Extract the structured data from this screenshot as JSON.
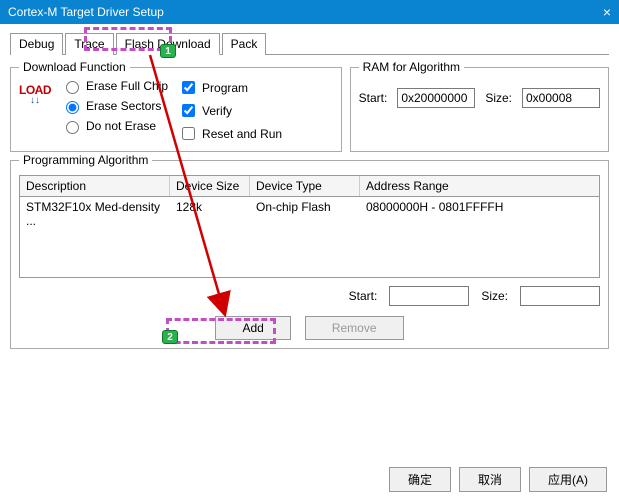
{
  "window": {
    "title": "Cortex-M Target Driver Setup"
  },
  "tabs": {
    "debug": "Debug",
    "trace": "Trace",
    "flash": "Flash Download",
    "pack": "Pack"
  },
  "download_function": {
    "legend": "Download Function",
    "icon_text": "LOAD",
    "radio_erase_full": "Erase Full Chip",
    "radio_erase_sectors": "Erase Sectors",
    "radio_do_not_erase": "Do not Erase",
    "chk_program": "Program",
    "chk_verify": "Verify",
    "chk_reset_run": "Reset and Run"
  },
  "ram_algorithm": {
    "legend": "RAM for Algorithm",
    "start_label": "Start:",
    "start_value": "0x20000000",
    "size_label": "Size:",
    "size_value": "0x00008"
  },
  "programming_algorithm": {
    "legend": "Programming Algorithm",
    "headers": {
      "desc": "Description",
      "size": "Device Size",
      "type": "Device Type",
      "addr": "Address Range"
    },
    "row": {
      "desc": "STM32F10x Med-density ...",
      "size": "128k",
      "type": "On-chip Flash",
      "addr": "08000000H - 0801FFFFH"
    },
    "start_label": "Start:",
    "start_value": "",
    "size_label": "Size:",
    "size_value": "",
    "add_button": "Add",
    "remove_button": "Remove"
  },
  "footer": {
    "ok": "确定",
    "cancel": "取消",
    "apply": "应用(A)"
  },
  "annotations": {
    "badge1": "1",
    "badge2": "2"
  }
}
